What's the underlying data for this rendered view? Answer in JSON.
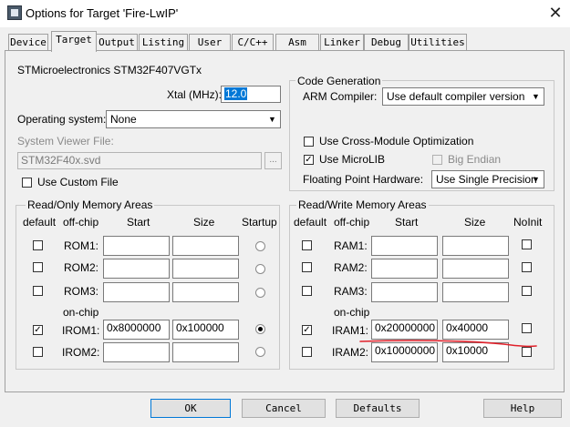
{
  "window": {
    "title": "Options for Target 'Fire-LwIP'"
  },
  "tabs": [
    "Device",
    "Target",
    "Output",
    "Listing",
    "User",
    "C/C++",
    "Asm",
    "Linker",
    "Debug",
    "Utilities"
  ],
  "device_name": "STMicroelectronics STM32F407VGTx",
  "xtal": {
    "label": "Xtal (MHz):",
    "value": "12.0"
  },
  "os": {
    "label": "Operating system:",
    "value": "None"
  },
  "svf": {
    "label": "System Viewer File:",
    "value": "STM32F40x.svd",
    "browse": "..."
  },
  "custom_file": {
    "label": "Use Custom File",
    "checked": false
  },
  "codegen": {
    "title": "Code Generation",
    "compiler_label": "ARM Compiler:",
    "compiler_value": "Use default compiler version",
    "cross_module": {
      "label": "Use Cross-Module Optimization",
      "checked": false
    },
    "microlib": {
      "label": "Use MicroLIB",
      "checked": true
    },
    "big_endian": {
      "label": "Big Endian",
      "checked": false
    },
    "fp_label": "Floating Point Hardware:",
    "fp_value": "Use Single Precision"
  },
  "rom": {
    "title": "Read/Only Memory Areas",
    "headers": {
      "default": "default",
      "offchip": "off-chip",
      "start": "Start",
      "size": "Size",
      "startup": "Startup"
    },
    "onchip": "on-chip",
    "rows": [
      {
        "name": "ROM1:",
        "start": "",
        "size": "",
        "default": false,
        "startup": false
      },
      {
        "name": "ROM2:",
        "start": "",
        "size": "",
        "default": false,
        "startup": false
      },
      {
        "name": "ROM3:",
        "start": "",
        "size": "",
        "default": false,
        "startup": false
      },
      {
        "name": "IROM1:",
        "start": "0x8000000",
        "size": "0x100000",
        "default": true,
        "startup": true
      },
      {
        "name": "IROM2:",
        "start": "",
        "size": "",
        "default": false,
        "startup": false
      }
    ]
  },
  "ram": {
    "title": "Read/Write Memory Areas",
    "headers": {
      "default": "default",
      "offchip": "off-chip",
      "start": "Start",
      "size": "Size",
      "noinit": "NoInit"
    },
    "onchip": "on-chip",
    "rows": [
      {
        "name": "RAM1:",
        "start": "",
        "size": "",
        "default": false,
        "noinit": false
      },
      {
        "name": "RAM2:",
        "start": "",
        "size": "",
        "default": false,
        "noinit": false
      },
      {
        "name": "RAM3:",
        "start": "",
        "size": "",
        "default": false,
        "noinit": false
      },
      {
        "name": "IRAM1:",
        "start": "0x20000000",
        "size": "0x40000",
        "default": true,
        "noinit": false
      },
      {
        "name": "IRAM2:",
        "start": "0x10000000",
        "size": "0x10000",
        "default": false,
        "noinit": false
      }
    ]
  },
  "buttons": {
    "ok": "OK",
    "cancel": "Cancel",
    "defaults": "Defaults",
    "help": "Help"
  },
  "annotation": {
    "color": "#e0202a"
  }
}
